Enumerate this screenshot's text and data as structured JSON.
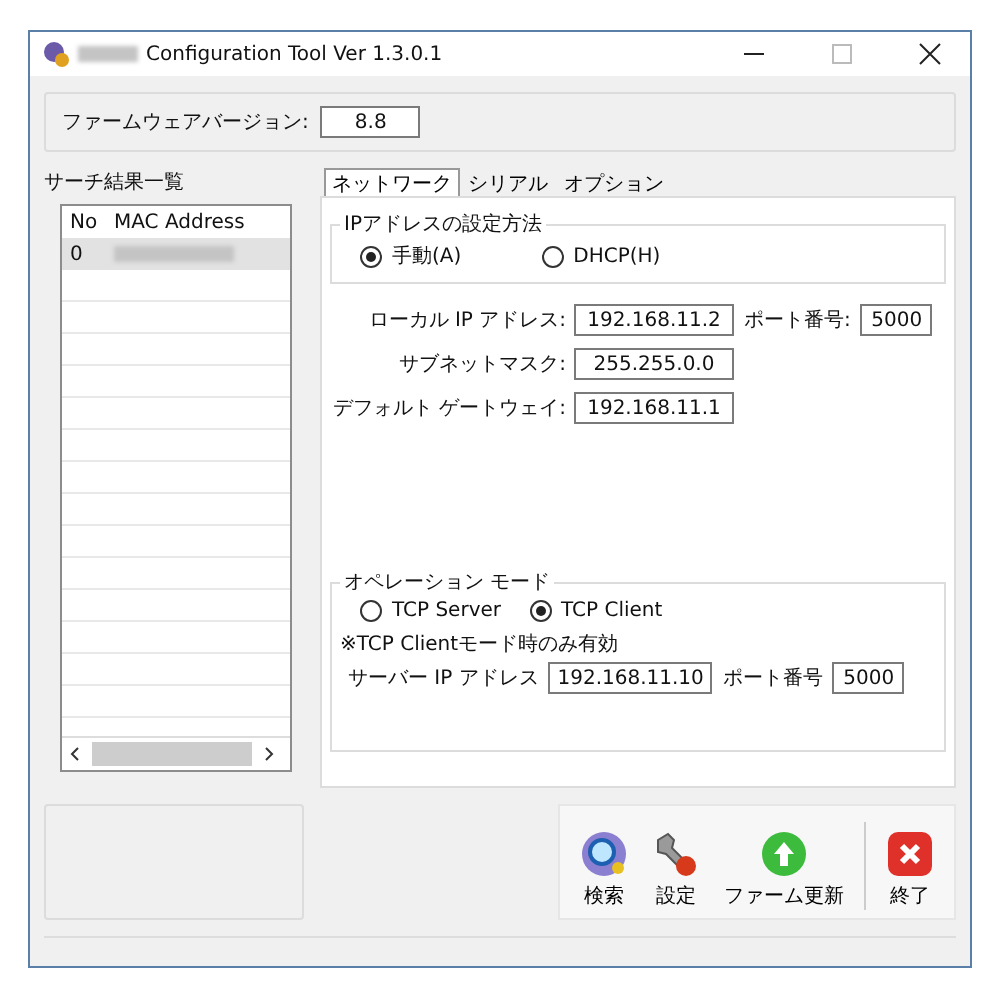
{
  "window": {
    "title": "Configuration Tool Ver 1.3.0.1"
  },
  "firmware": {
    "label": "ファームウェアバージョン:",
    "value": "8.8"
  },
  "search_results": {
    "title": "サーチ結果一覧",
    "columns": [
      "No",
      "MAC Address"
    ],
    "rows": [
      {
        "no": "0",
        "selected": true
      }
    ]
  },
  "tabs": [
    {
      "label": "ネットワーク",
      "selected": true
    },
    {
      "label": "シリアル",
      "selected": false
    },
    {
      "label": "オプション",
      "selected": false
    }
  ],
  "ip_method": {
    "title": "IPアドレスの設定方法",
    "options": [
      {
        "label": "手動(A)",
        "selected": true
      },
      {
        "label": "DHCP(H)",
        "selected": false
      }
    ]
  },
  "local_ip": {
    "label": "ローカル IP アドレス:",
    "value": "192.168.11.2",
    "port_label": "ポート番号:",
    "port": "5000"
  },
  "subnet": {
    "label": "サブネットマスク:",
    "value": "255.255.0.0"
  },
  "gateway": {
    "label": "デフォルト ゲートウェイ:",
    "value": "192.168.11.1"
  },
  "operation_mode": {
    "title": "オペレーション モード",
    "options": [
      {
        "label": "TCP Server",
        "selected": false
      },
      {
        "label": "TCP Client",
        "selected": true
      }
    ],
    "note": "※TCP Clientモード時のみ有効",
    "server_label": "サーバー IP アドレス",
    "server_ip": "192.168.11.10",
    "port_label": "ポート番号",
    "port": "5000"
  },
  "toolbar": [
    {
      "kind": "search",
      "label": "検索"
    },
    {
      "kind": "settings",
      "label": "設定"
    },
    {
      "kind": "update",
      "label": "ファーム更新"
    },
    {
      "kind": "exit",
      "label": "終了"
    }
  ]
}
